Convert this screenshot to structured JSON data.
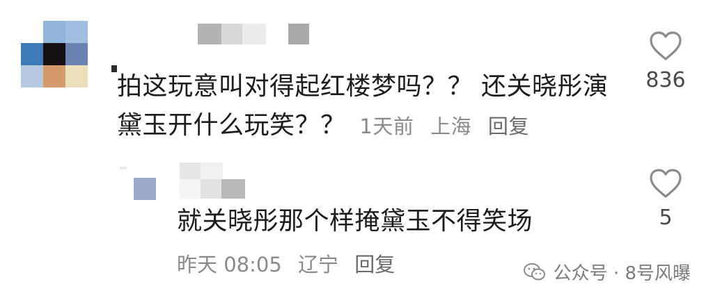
{
  "comment": {
    "text_line1": "拍这玩意叫对得起红楼梦吗？？ 还关晓彤演",
    "text_line2": "黛玉开什么玩笑？？",
    "time": "1天前",
    "location": "上海",
    "reply_label": "回复",
    "like_count": "836"
  },
  "reply": {
    "text": "就关晓彤那个样掩黛玉不得笑场",
    "time": "昨天 08:05",
    "location": "辽宁",
    "reply_label": "回复",
    "like_count": "5"
  },
  "watermark": {
    "text": "公众号 · 8号风曝"
  },
  "colors": {
    "text": "#1d1d1d",
    "meta": "#8a8a8a",
    "heart": "#8b8b8b"
  },
  "icons": {
    "like": "heart-outline-icon",
    "watermark": "wechat-icon"
  }
}
